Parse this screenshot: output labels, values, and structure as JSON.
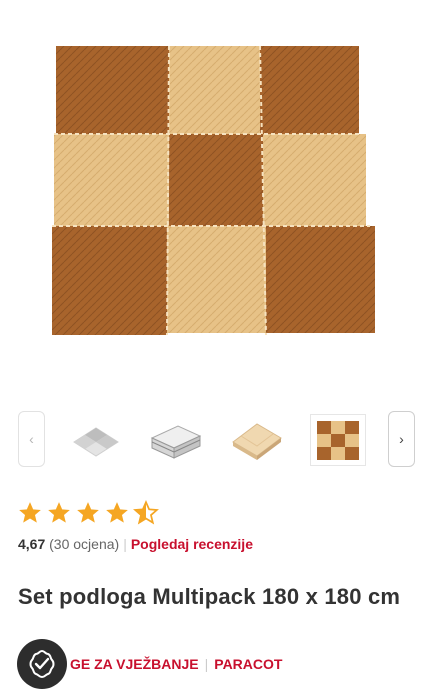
{
  "gallery": {
    "main_image_alt": "puzzle-mat-set-brown-beige",
    "prev_label": "‹",
    "next_label": "›",
    "thumbnails": [
      {
        "name": "thumb-grey-mats"
      },
      {
        "name": "thumb-stacked-mats"
      },
      {
        "name": "thumb-beige-stack"
      },
      {
        "name": "thumb-brown-set",
        "active": true
      }
    ]
  },
  "rating": {
    "value": "4,67",
    "count": "(30 ocjena)",
    "reviews_link": "Pogledaj recenzije",
    "stars": 4.5,
    "star_color": "#f5a623"
  },
  "product": {
    "title": "Set podloga Multipack 180 x 180 cm"
  },
  "categories": {
    "items": [
      "GE ZA VJEŽBANJE",
      "PARACOT"
    ]
  },
  "colors": {
    "accent": "#c8102e",
    "mat_brown": "#a8642c",
    "mat_beige": "#e8c48a"
  }
}
